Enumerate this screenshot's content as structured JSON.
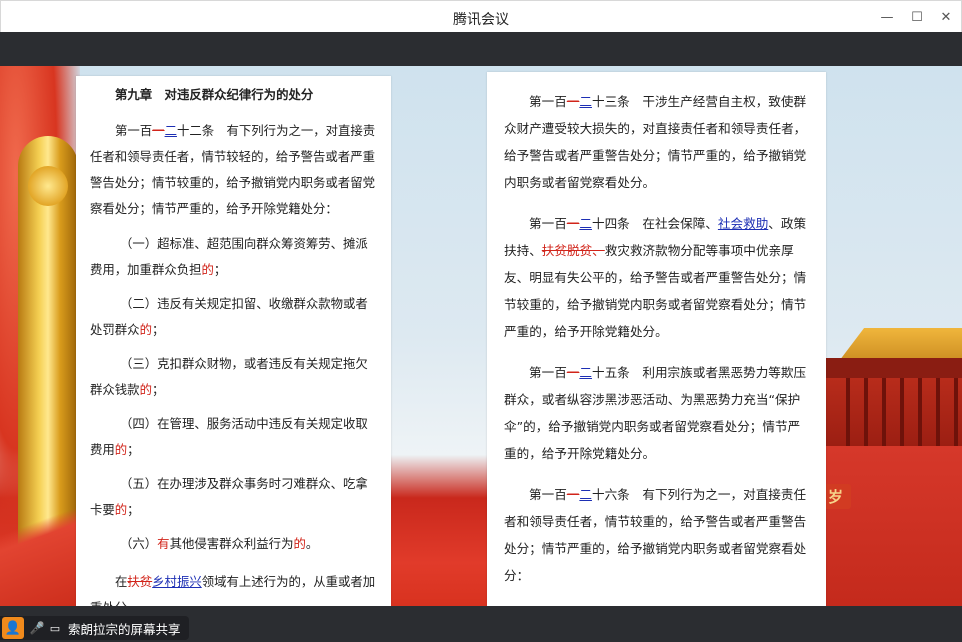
{
  "window": {
    "title": "腾讯会议",
    "minimize_glyph": "—",
    "maximize_glyph": "☐",
    "close_glyph": "✕"
  },
  "background": {
    "sign_text": "岁"
  },
  "left_page": {
    "chapter": "第九章　对违反群众纪律行为的处分",
    "article": {
      "pre": "第一百",
      "del": "一",
      "ins": "二",
      "rest": "十二条　有下列行为之一，对直接责任者和领导责任者，情节较轻的，给予警告或者严重警告处分；情节较重的，给予撤销党内职务或者留党察看处分；情节严重的，给予开除党籍处分："
    },
    "items": [
      {
        "text": "（一）超标准、超范围向群众筹资筹劳、摊派费用，加重群众负担",
        "ins": "的",
        "end": "；"
      },
      {
        "text": "（二）违反有关规定扣留、收缴群众款物或者处罚群众",
        "ins": "的",
        "end": "；"
      },
      {
        "text": "（三）克扣群众财物，或者违反有关规定拖欠群众钱款",
        "ins": "的",
        "end": "；"
      },
      {
        "text": "（四）在管理、服务活动中违反有关规定收取费用",
        "ins": "的",
        "end": "；"
      },
      {
        "text": "（五）在办理涉及群众事务时刁难群众、吃拿卡要",
        "ins": "的",
        "end": "；"
      }
    ],
    "item6": {
      "pre": "（六）",
      "ins1": "有",
      "mid": "其他侵害群众利益行为",
      "ins2": "的",
      "end": "。"
    },
    "final": {
      "pre": "在",
      "del": "扶贫",
      "ins": "乡村振兴",
      "rest": "领域有上述行为的，从重或者加重处分。"
    }
  },
  "right_page": {
    "a123": {
      "pre": "第一百",
      "del": "一",
      "ins": "二",
      "rest": "十三条　干涉生产经营自主权，致使群众财产遭受较大损失的，对直接责任者和领导责任者，给予警告或者严重警告处分；情节严重的，给予撤销党内职务或者留党察看处分。"
    },
    "a124": {
      "pre": "第一百",
      "del": "一",
      "ins": "二",
      "mid1": "十四条　在社会保障、",
      "ins2": "社会救助",
      "mid2": "、政策扶持、",
      "del2": "扶贫脱贫、",
      "rest": "救灾救济款物分配等事项中优亲厚友、明显有失公平的，给予警告或者严重警告处分；情节较重的，给予撤销党内职务或者留党察看处分；情节严重的，给予开除党籍处分。"
    },
    "a125": {
      "pre": "第一百",
      "del": "一",
      "ins": "二",
      "rest": "十五条　利用宗族或者黑恶势力等欺压群众，或者纵容涉黑涉恶活动、为黑恶势力充当“保护伞”的，给予撤销党内职务或者留党察看处分；情节严重的，给予开除党籍处分。"
    },
    "a126": {
      "pre": "第一百",
      "del": "一",
      "ins": "二",
      "rest": "十六条　有下列行为之一，对直接责任者和领导责任者，情节较重的，给予警告或者严重警告处分；情节严重的，给予撤销党内职务或者留党察看处分："
    }
  },
  "status_bar": {
    "avatar_glyph": "👤",
    "mic_glyph": "🎤",
    "screen_glyph": "▭",
    "share_label": "索朗拉宗的屏幕共享"
  },
  "colors": {
    "insert_red": "#d1241a",
    "insert_blue": "#1d2fb4",
    "dark_bar": "#2b2d31",
    "avatar_orange": "#f08a1c",
    "mic_green": "#39b54a"
  }
}
